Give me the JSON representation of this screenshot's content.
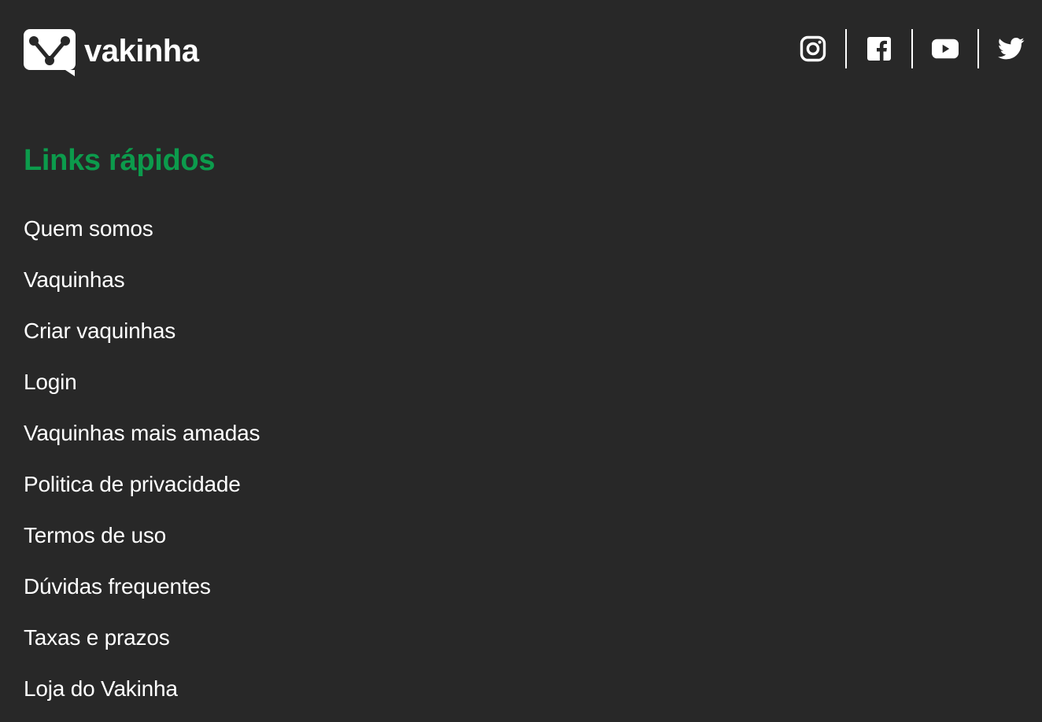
{
  "brand": {
    "name": "vakinha",
    "logo_icon": "v-speech-bubble-logo",
    "logo_color": "#ffffff"
  },
  "social": [
    {
      "name": "Instagram",
      "icon": "instagram-icon"
    },
    {
      "name": "Facebook",
      "icon": "facebook-icon"
    },
    {
      "name": "YouTube",
      "icon": "youtube-icon"
    },
    {
      "name": "Twitter",
      "icon": "twitter-icon"
    }
  ],
  "quick_links": {
    "title": "Links rápidos",
    "title_color": "#0c9b4c",
    "items": [
      {
        "label": "Quem somos"
      },
      {
        "label": "Vaquinhas"
      },
      {
        "label": "Criar vaquinhas"
      },
      {
        "label": "Login"
      },
      {
        "label": "Vaquinhas mais amadas"
      },
      {
        "label": "Politica de privacidade"
      },
      {
        "label": "Termos de uso"
      },
      {
        "label": "Dúvidas frequentes"
      },
      {
        "label": "Taxas e prazos"
      },
      {
        "label": "Loja do Vakinha"
      }
    ]
  },
  "colors": {
    "background": "#282828",
    "text": "#ffffff",
    "accent": "#0c9b4c"
  }
}
